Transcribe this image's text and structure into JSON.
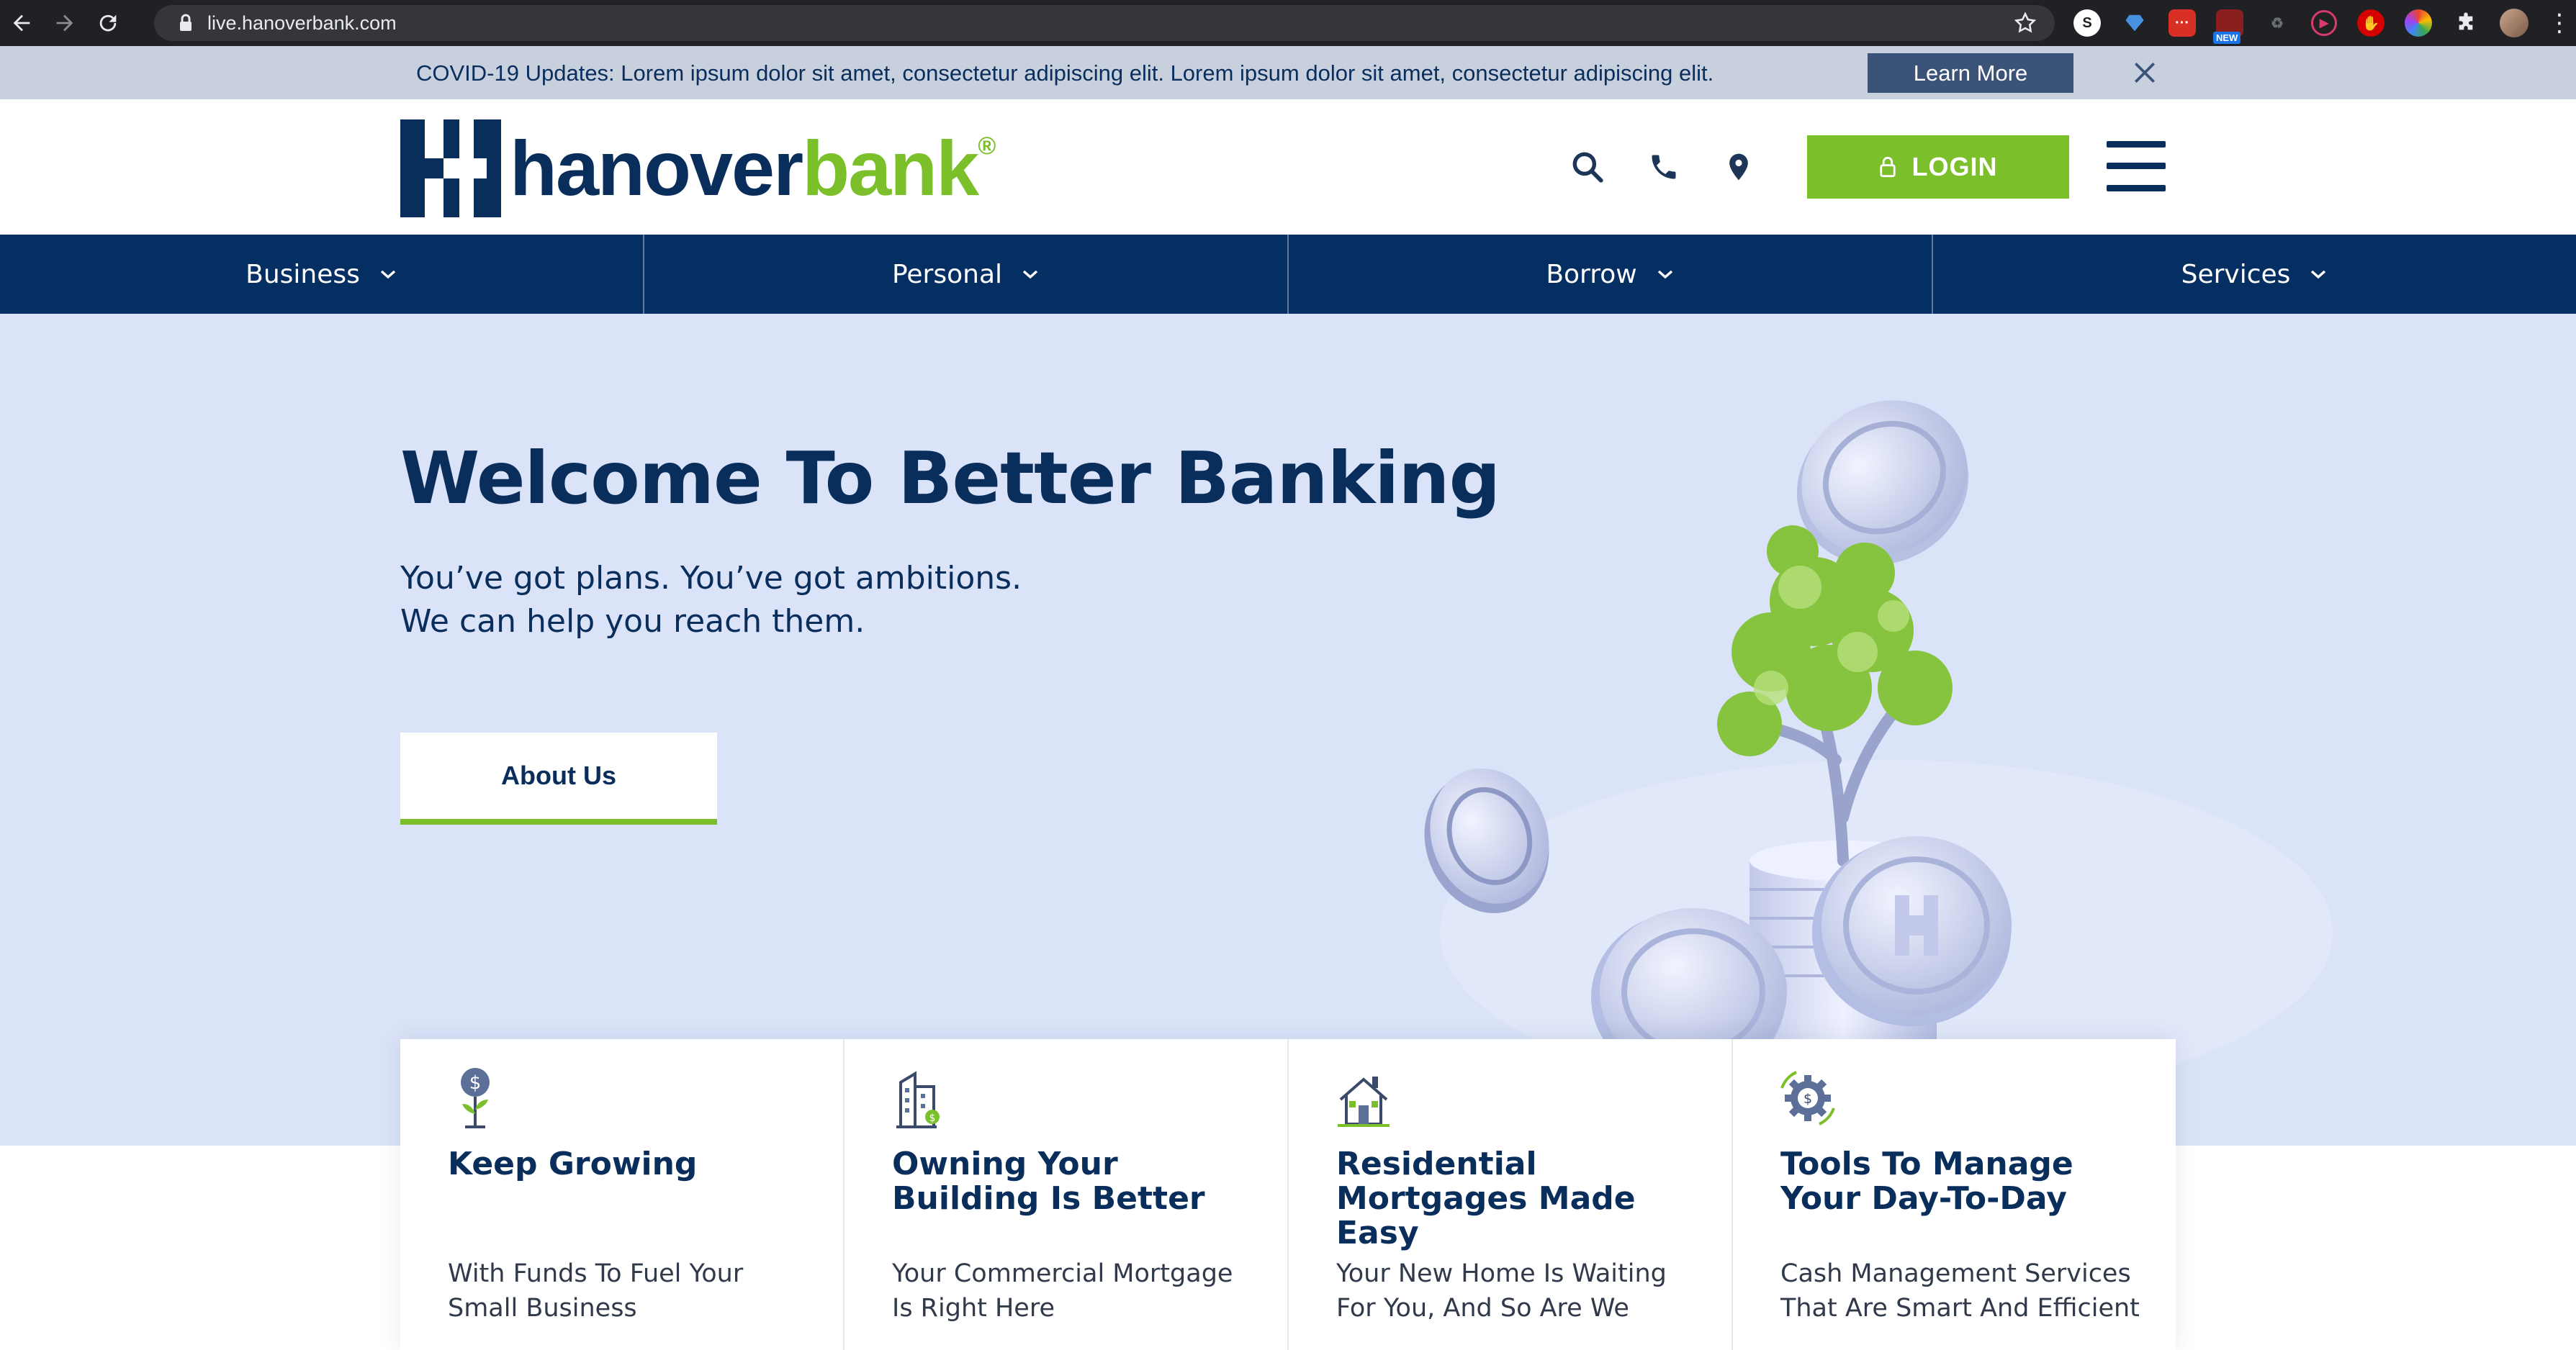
{
  "browser": {
    "url": "live.hanoverbank.com",
    "extensions": [
      "s-extension-icon",
      "gem-extension-icon",
      "dots-extension-icon",
      "new-extension-icon",
      "recycle-extension-icon",
      "play-extension-icon",
      "stop-extension-icon",
      "color-wheel-extension-icon",
      "puzzle-icon"
    ],
    "extension_badge": "NEW"
  },
  "covid_banner": {
    "text": "COVID-19 Updates: Lorem ipsum dolor sit amet, consectetur adipiscing elit. Lorem ipsum dolor sit amet, consectetur adipiscing elit.",
    "button_label": "Learn More"
  },
  "header": {
    "logo_part1": "hanover",
    "logo_part2": "bank",
    "logo_reg": "®",
    "icons": [
      "search-icon",
      "phone-icon",
      "location-pin-icon"
    ],
    "login_label": "LOGIN"
  },
  "nav": {
    "items": [
      {
        "label": "Business"
      },
      {
        "label": "Personal"
      },
      {
        "label": "Borrow"
      },
      {
        "label": "Services"
      }
    ]
  },
  "hero": {
    "title": "Welcome To Better Banking",
    "subtitle_line1": "You’ve got plans. You’ve got ambitions.",
    "subtitle_line2": "We can help you reach them.",
    "button_label": "About Us"
  },
  "cards": [
    {
      "icon": "money-plant-icon",
      "title": "Keep Growing",
      "desc_line1": "With Funds To Fuel Your",
      "desc_line2": "Small Business"
    },
    {
      "icon": "office-building-icon",
      "title": "Owning Your Building Is Better",
      "desc_line1": "Your Commercial Mortgage",
      "desc_line2": "Is Right Here"
    },
    {
      "icon": "house-icon",
      "title": "Residential Mortgages Made Easy",
      "desc_line1": "Your New Home Is Waiting",
      "desc_line2": "For You, And So Are We"
    },
    {
      "icon": "gear-dollar-icon",
      "title": "Tools To Manage Your Day-To-Day",
      "desc_line1": "Cash Management Services",
      "desc_line2": "That Are Smart And Efficient"
    }
  ],
  "colors": {
    "navy": "#0a2e5c",
    "nav_bg": "#052f62",
    "green": "#7bbf2a",
    "hero_bg": "#dbe3f8",
    "banner_bg": "#c8d0dd"
  }
}
